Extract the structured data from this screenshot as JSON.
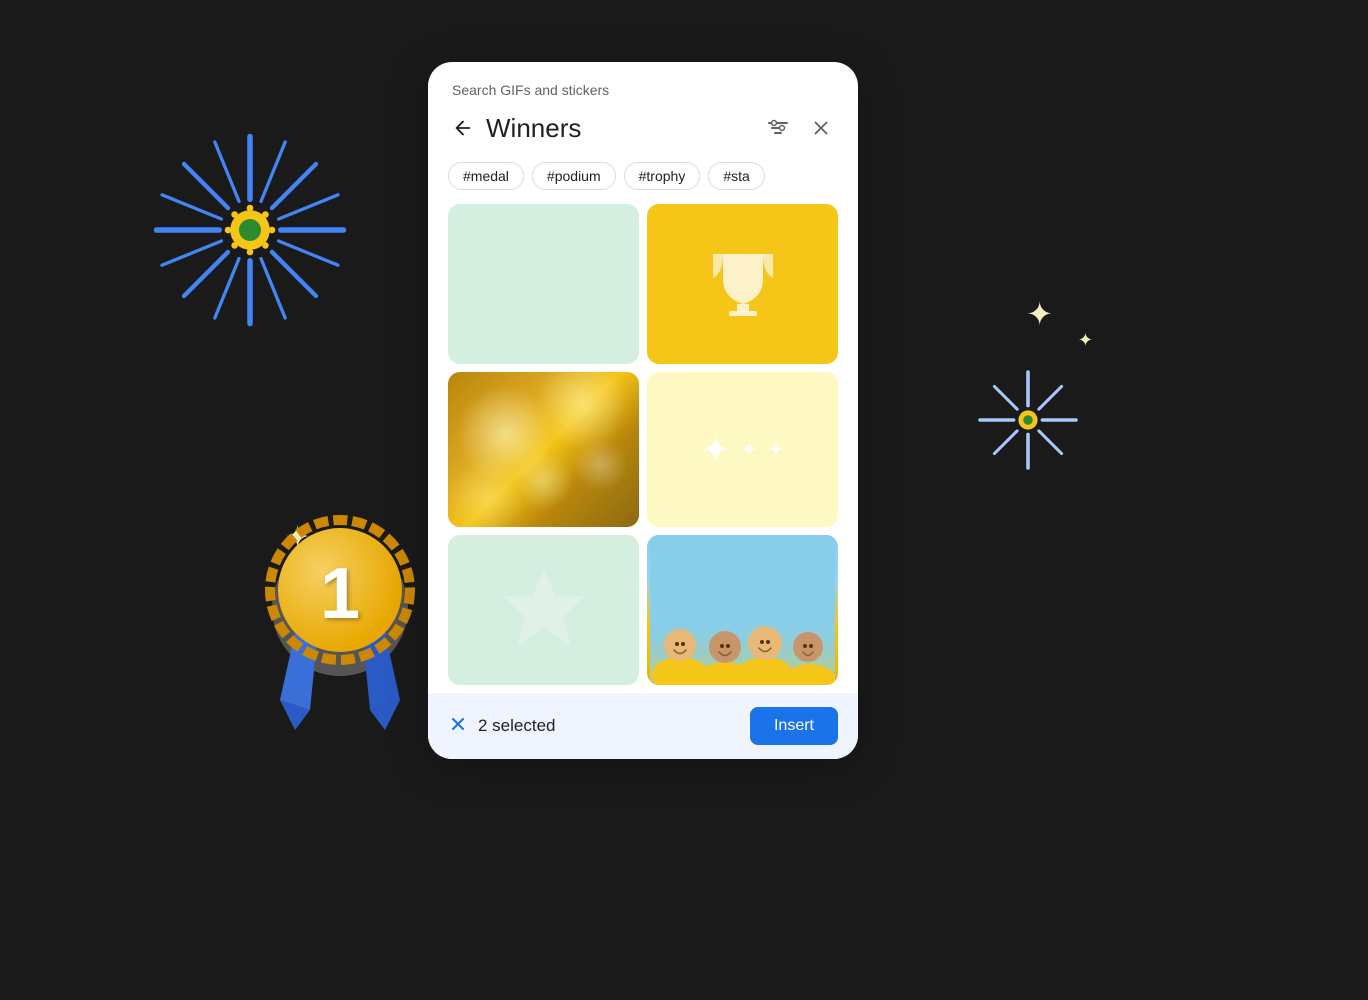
{
  "background": "#1a1a1a",
  "dialog": {
    "header_label": "Search GIFs and stickers",
    "title": "Winners",
    "tags": [
      "#medal",
      "#podium",
      "#trophy",
      "#sta"
    ],
    "cells": [
      {
        "id": 1,
        "type": "blank-green",
        "alt": "blank green GIF"
      },
      {
        "id": 2,
        "type": "trophy",
        "alt": "trophy GIF"
      },
      {
        "id": 3,
        "type": "gold-bokeh",
        "alt": "gold bokeh GIF"
      },
      {
        "id": 4,
        "type": "sparkles",
        "alt": "sparkles GIF"
      },
      {
        "id": 5,
        "type": "star",
        "alt": "star GIF"
      },
      {
        "id": 6,
        "type": "people",
        "alt": "team celebration GIF"
      }
    ]
  },
  "bottom_bar": {
    "selected_count": "2 selected",
    "insert_label": "Insert",
    "clear_label": "×"
  },
  "icons": {
    "back": "←",
    "close": "×",
    "filter": "filter-icon"
  }
}
